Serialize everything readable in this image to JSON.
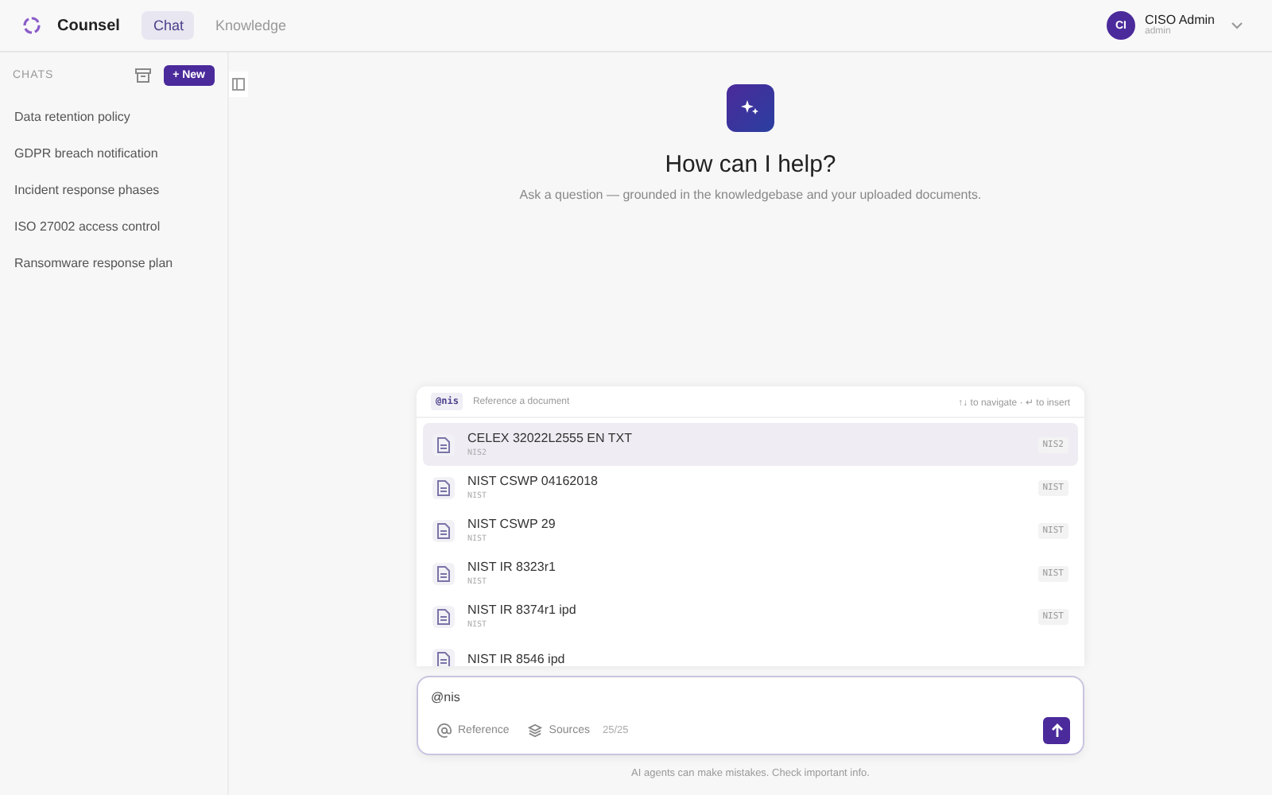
{
  "header": {
    "brand": "Counsel",
    "tabs": [
      {
        "label": "Chat",
        "selected": true
      },
      {
        "label": "Knowledge",
        "selected": false
      }
    ],
    "user": {
      "initials": "CI",
      "name": "CISO Admin",
      "role": "admin"
    }
  },
  "sidebar": {
    "heading": "CHATS",
    "new_button": "+ New",
    "items": [
      {
        "label": "Data retention policy"
      },
      {
        "label": "GDPR breach notification"
      },
      {
        "label": "Incident response phases"
      },
      {
        "label": "ISO 27002 access control"
      },
      {
        "label": "Ransomware response plan"
      }
    ]
  },
  "hero": {
    "title": "How can I help?",
    "subtitle": "Ask a question — grounded in the knowledgebase and your uploaded documents."
  },
  "mention_menu": {
    "query": "@nis",
    "hint": "Reference a document",
    "keys": "↑↓ to navigate · ↵ to insert",
    "items": [
      {
        "title": "CELEX 32022L2555 EN TXT",
        "sub": "NIS2",
        "tag": "NIS2",
        "selected": true
      },
      {
        "title": "NIST CSWP 04162018",
        "sub": "NIST",
        "tag": "NIST",
        "selected": false
      },
      {
        "title": "NIST CSWP 29",
        "sub": "NIST",
        "tag": "NIST",
        "selected": false
      },
      {
        "title": "NIST IR 8323r1",
        "sub": "NIST",
        "tag": "NIST",
        "selected": false
      },
      {
        "title": "NIST IR 8374r1 ipd",
        "sub": "NIST",
        "tag": "NIST",
        "selected": false
      },
      {
        "title": "NIST IR 8546 ipd",
        "selected": false
      }
    ]
  },
  "composer": {
    "value": "@nis",
    "reference_button": "Reference",
    "sources_button": "Sources",
    "sources_count": "25/25"
  },
  "footer": "AI agents can make mistakes. Check important info."
}
